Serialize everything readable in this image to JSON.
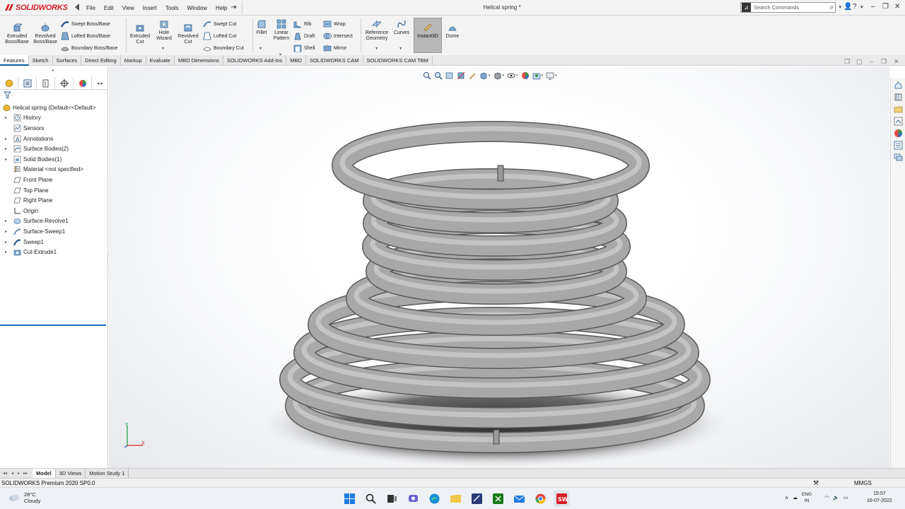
{
  "app": {
    "logo_text": "SOLIDWORKS",
    "document_title": "Helical spring *"
  },
  "menu": [
    "File",
    "Edit",
    "View",
    "Insert",
    "Tools",
    "Window",
    "Help"
  ],
  "search": {
    "placeholder": "Search Commands"
  },
  "ribbon": {
    "extruded_boss": [
      "Extruded",
      "Boss/Base"
    ],
    "revolved_boss": [
      "Revolved",
      "Boss/Base"
    ],
    "swept_boss": "Swept Boss/Base",
    "lofted_boss": "Lofted Boss/Base",
    "boundary_boss": "Boundary Boss/Base",
    "extruded_cut": [
      "Extruded",
      "Cut"
    ],
    "hole_wizard": [
      "Hole",
      "Wizard"
    ],
    "revolved_cut": [
      "Revolved",
      "Cut"
    ],
    "swept_cut": "Swept Cut",
    "lofted_cut": "Lofted Cut",
    "boundary_cut": "Boundary Cut",
    "fillet": "Fillet",
    "linear_pattern": [
      "Linear",
      "Pattern"
    ],
    "rib": "Rib",
    "draft": "Draft",
    "shell": "Shell",
    "wrap": "Wrap",
    "intersect": "Intersect",
    "mirror": "Mirror",
    "reference_geometry": [
      "Reference",
      "Geometry"
    ],
    "curves": "Curves",
    "instant3d": "Instant3D",
    "dome": "Dome"
  },
  "tabs": [
    "Features",
    "Sketch",
    "Surfaces",
    "Direct Editing",
    "Markup",
    "Evaluate",
    "MBD Dimensions",
    "SOLIDWORKS Add-Ins",
    "MBD",
    "SOLIDWORKS CAM",
    "SOLIDWORKS CAM TBM"
  ],
  "feature_tree": {
    "root": "Helical spring  (Default<<Default>",
    "items": [
      {
        "label": "History",
        "expandable": true
      },
      {
        "label": "Sensors",
        "expandable": false
      },
      {
        "label": "Annotations",
        "expandable": true
      },
      {
        "label": "Surface Bodies(2)",
        "expandable": true
      },
      {
        "label": "Solid Bodies(1)",
        "expandable": true
      },
      {
        "label": "Material <not specified>",
        "expandable": false
      },
      {
        "label": "Front Plane",
        "expandable": false
      },
      {
        "label": "Top Plane",
        "expandable": false
      },
      {
        "label": "Right Plane",
        "expandable": false
      },
      {
        "label": "Origin",
        "expandable": false
      },
      {
        "label": "Surface-Revolve1",
        "expandable": true
      },
      {
        "label": "Surface-Sweep1",
        "expandable": true
      },
      {
        "label": "Sweep1",
        "expandable": true
      },
      {
        "label": "Cut-Extrude1",
        "expandable": true
      }
    ]
  },
  "bottom_tabs": [
    "Model",
    "3D Views",
    "Motion Study 1"
  ],
  "status": {
    "version": "SOLIDWORKS Premium 2020 SP0.0",
    "units": "MMGS"
  },
  "taskbar": {
    "temperature": "28°C",
    "condition": "Cloudy",
    "language": [
      "ENG",
      "IN"
    ],
    "time": "15:57",
    "date": "16-07-2022"
  },
  "triad_labels": {
    "y": "Y",
    "x": "X"
  },
  "colors": {
    "brand_red": "#d81d25",
    "selection_blue": "#1b6ec2",
    "spring_gray": "#a8a8a8",
    "instant3d_active": "#b8b8b8"
  }
}
